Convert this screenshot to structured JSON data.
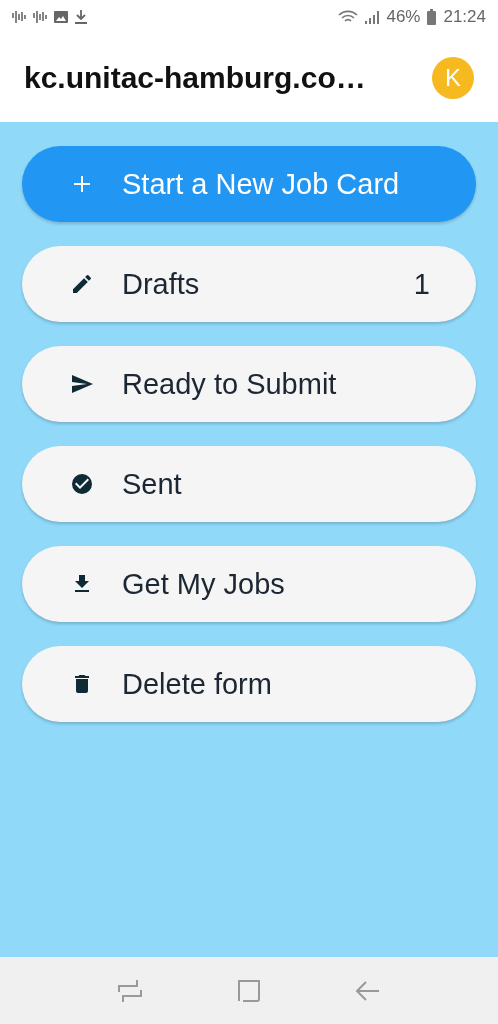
{
  "status_bar": {
    "battery": "46%",
    "time": "21:24"
  },
  "header": {
    "title": "kc.unitac-hamburg.co…",
    "avatar": "K"
  },
  "menu": [
    {
      "kind": "primary",
      "label": "Start a New Job Card"
    },
    {
      "kind": "secondary",
      "label": "Drafts",
      "count": "1"
    },
    {
      "kind": "secondary",
      "label": "Ready to Submit"
    },
    {
      "kind": "secondary",
      "label": "Sent"
    },
    {
      "kind": "secondary",
      "label": "Get My Jobs"
    },
    {
      "kind": "secondary",
      "label": "Delete form"
    }
  ]
}
